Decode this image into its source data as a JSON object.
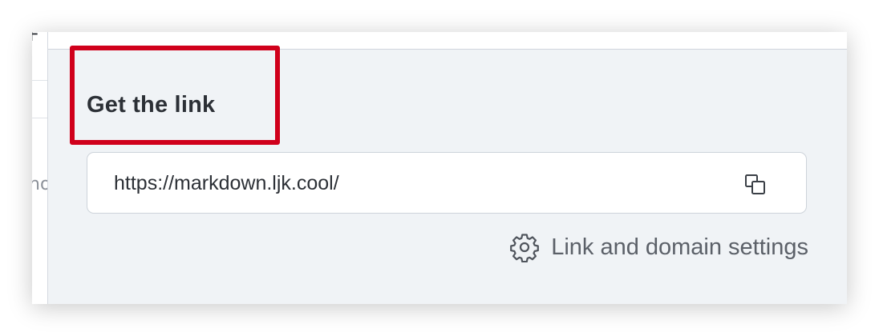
{
  "left_strip": {
    "top_fragment": "F",
    "mid_fragment": "no"
  },
  "panel": {
    "title": "Get the link",
    "link_field": {
      "value": "https://markdown.ljk.cool/",
      "copy_icon": "copy-icon"
    },
    "settings_link": {
      "icon": "gear-icon",
      "label": "Link and domain settings"
    }
  },
  "annotation": {
    "highlight_color": "#d0001b"
  },
  "colors": {
    "panel_bg": "#f0f3f6",
    "text_primary": "#2c3036",
    "text_secondary": "#5b6068",
    "field_border": "#cdd3da"
  }
}
